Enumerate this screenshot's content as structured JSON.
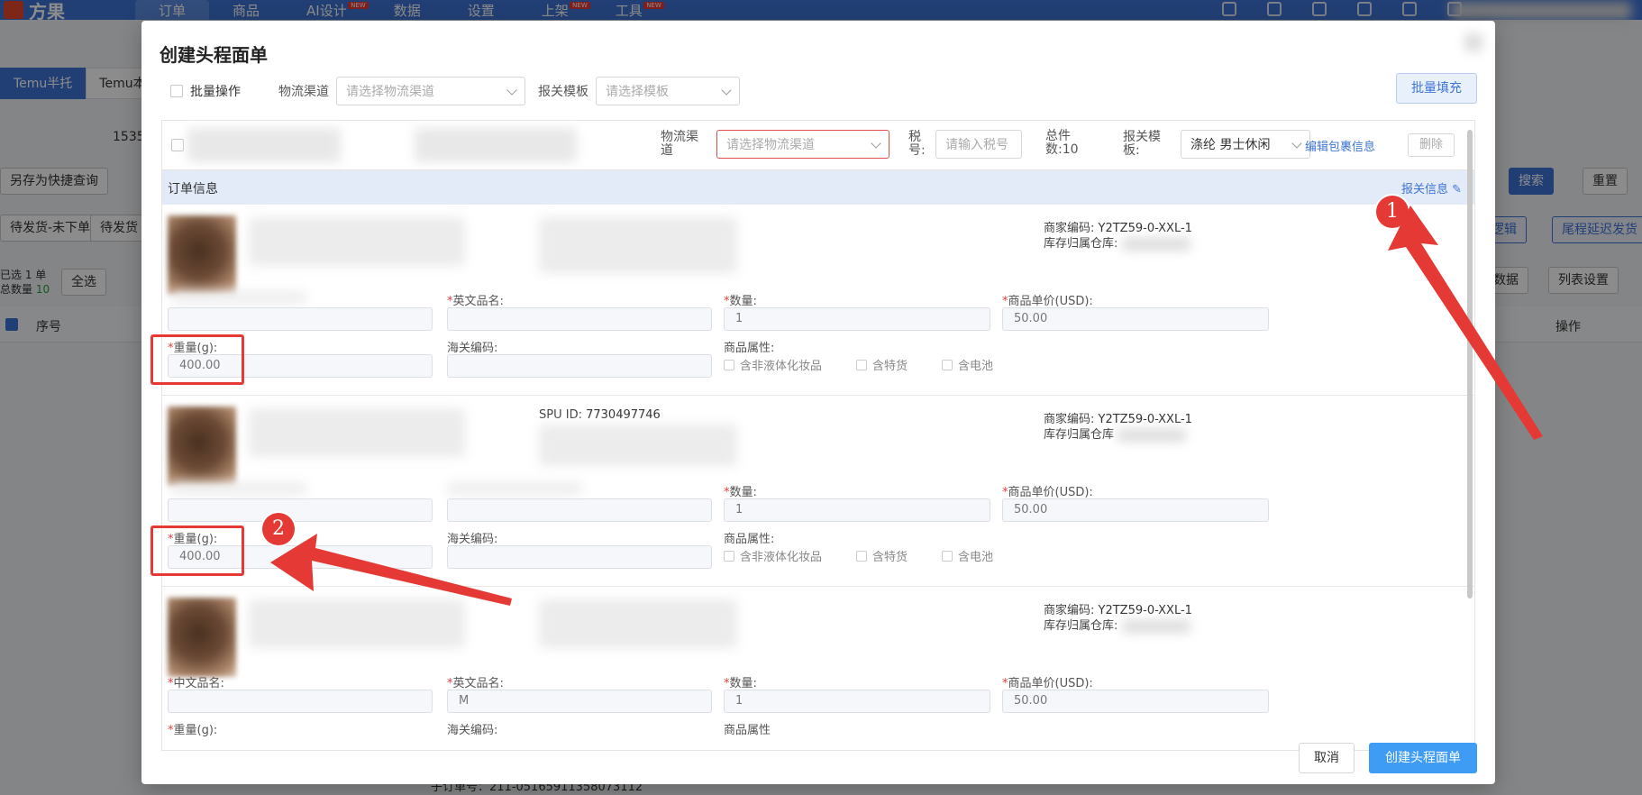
{
  "app": {
    "brand": "方果",
    "nav": [
      {
        "label": "订单",
        "badge": ""
      },
      {
        "label": "商品",
        "badge": ""
      },
      {
        "label": "AI设计",
        "badge": "NEW"
      },
      {
        "label": "数据",
        "badge": ""
      },
      {
        "label": "设置",
        "badge": ""
      },
      {
        "label": "上架",
        "badge": "NEW"
      },
      {
        "label": "工具",
        "badge": "NEW"
      }
    ],
    "tabs": [
      "Temu半托",
      "Temu本"
    ],
    "search_fragment": "1535",
    "save_query": "另存为快捷查询",
    "status_tabs": [
      "待发货-未下单",
      "待发货"
    ],
    "selected_orders": "已选 1 单",
    "total_qty_label": "总数量",
    "total_qty": "10",
    "select_all": "全选",
    "search_btn": "搜索",
    "reset_btn": "重置",
    "logic_btn": "配逻辑",
    "delay_btn": "尾程延迟发货",
    "data_btn": "出数据",
    "list_settings": "列表设置",
    "col_index": "序号",
    "col_actions": "操作",
    "bottom_order_no": "子订单号：211-05165911358073112"
  },
  "modal": {
    "title": "创建头程面单",
    "batch_label": "批量操作",
    "channel_label": "物流渠道",
    "channel_placeholder": "请选择物流渠道",
    "template_label": "报关模板",
    "template_placeholder": "请选择模板",
    "batch_fill": "批量填充",
    "pkg": {
      "channel_label": "物流渠道",
      "channel_placeholder": "请选择物流渠道",
      "tax_label": "税号:",
      "tax_placeholder": "请输入税号",
      "total_label": "总件数:",
      "total_value": "10",
      "template_label": "报关模板:",
      "template_value": "涤纶 男士休闲",
      "edit_link": "编辑包裹信息",
      "delete_btn": "删除"
    },
    "section_title": "订单信息",
    "customs_link": "报关信息",
    "items": [
      {
        "sku": "Y2TZ59-0-XXL-1",
        "sku_label": "商家编码:",
        "warehouse_label": "库存归属仓库:",
        "sku_id_label": "",
        "sku_id": "",
        "cn_label": "",
        "en_label": "英文品名:",
        "en_value": "",
        "qty_label": "数量:",
        "qty_value": "1",
        "price_label": "商品单价(USD):",
        "price_value": "50.00",
        "weight_label": "重量(g):",
        "weight_value": "400.00",
        "hs_label": "海关编码:",
        "attr_label": "商品属性:",
        "attrs": [
          "含非液体化妆品",
          "含特货",
          "含电池"
        ]
      },
      {
        "sku": "Y2TZ59-0-XXL-1",
        "sku_label": "商家编码:",
        "warehouse_label": "库存归属仓库",
        "sku_id_label": "SPU ID:",
        "sku_id": "7730497746",
        "cn_label": "",
        "en_label": "",
        "en_value": "",
        "qty_label": "数量:",
        "qty_value": "1",
        "price_label": "商品单价(USD):",
        "price_value": "50.00",
        "weight_label": "重量(g):",
        "weight_value": "400.00",
        "hs_label": "海关编码:",
        "attr_label": "商品属性:",
        "attrs": [
          "含非液体化妆品",
          "含特货",
          "含电池"
        ]
      },
      {
        "sku": "Y2TZ59-0-XXL-1",
        "sku_label": "商家编码:",
        "warehouse_label": "库存归属仓库:",
        "sku_id_label": "",
        "sku_id": "",
        "cn_label": "中文品名:",
        "en_label": "英文品名:",
        "en_value": "M",
        "qty_label": "数量:",
        "qty_value": "1",
        "price_label": "商品单价(USD):",
        "price_value": "50.00",
        "weight_label": "重量(g):",
        "weight_value": "",
        "hs_label": "海关编码:",
        "attr_label": "商品属性",
        "attrs": []
      }
    ],
    "annotations": [
      "1",
      "2"
    ],
    "cancel": "取消",
    "submit": "创建头程面单"
  }
}
